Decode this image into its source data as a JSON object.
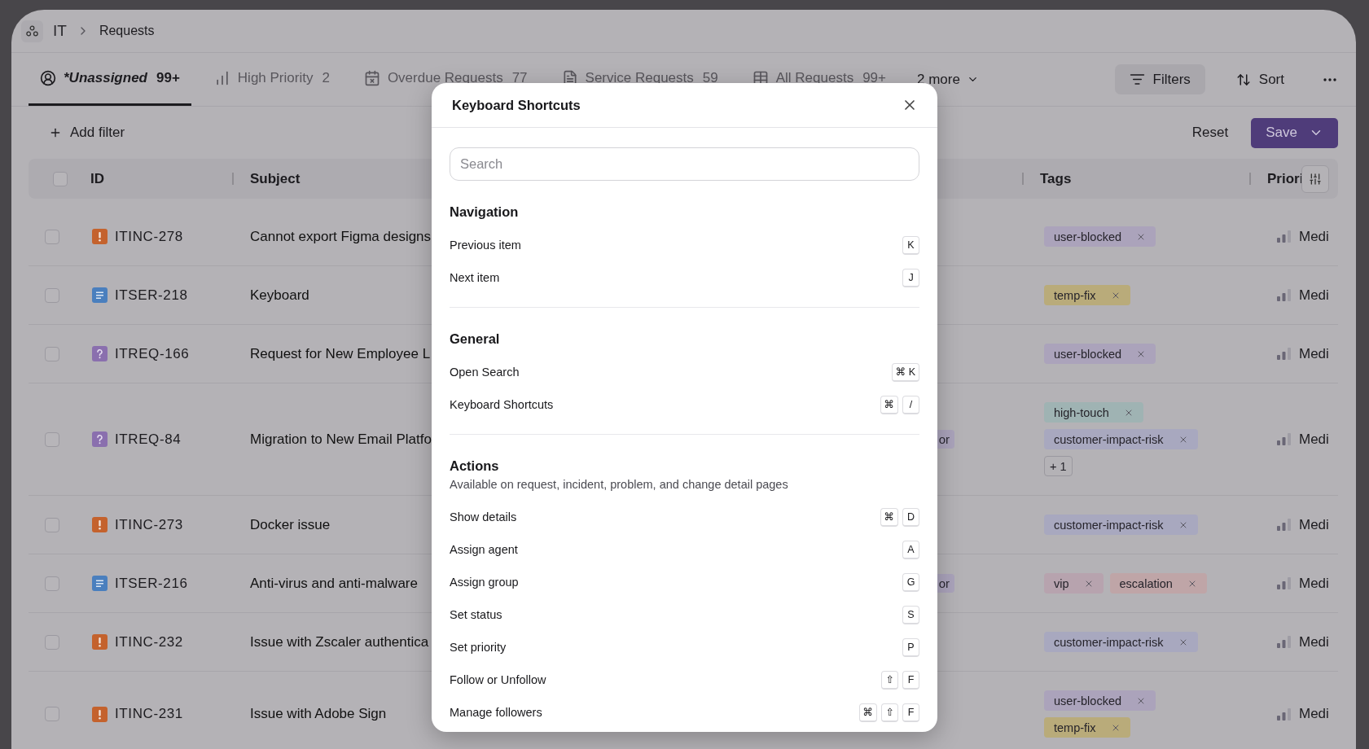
{
  "breadcrumb": {
    "items": [
      "IT",
      "Requests"
    ]
  },
  "tabs": [
    {
      "label": "*Unassigned",
      "count": "99+",
      "selected": true
    },
    {
      "label": "High Priority",
      "count": "2",
      "selected": false
    },
    {
      "label": "Overdue Requests",
      "count": "77",
      "selected": false
    },
    {
      "label": "Service Requests",
      "count": "59",
      "selected": false
    },
    {
      "label": "All Requests",
      "count": "99+",
      "selected": false
    }
  ],
  "more_tabs": "2 more",
  "toolbar": {
    "filters": "Filters",
    "sort": "Sort"
  },
  "add_filter": "Add filter",
  "actions": {
    "reset": "Reset",
    "save": "Save"
  },
  "table": {
    "header_checked": false,
    "columns": [
      "ID",
      "Subject",
      "Tags",
      "Priori"
    ],
    "rows": [
      {
        "checked": false,
        "kind": "incident",
        "id": "ITINC-278",
        "subject": "Cannot export Figma designs",
        "tag_lines": [
          [
            {
              "label": "user-blocked",
              "color": "#aba3bb"
            }
          ]
        ],
        "priority": "Medi"
      },
      {
        "checked": false,
        "kind": "service",
        "id": "ITSER-218",
        "subject": "Keyboard",
        "tag_lines": [
          [
            {
              "label": "temp-fix",
              "color": "#b9ab7a"
            }
          ]
        ],
        "priority": "Medi"
      },
      {
        "checked": false,
        "kind": "request",
        "id": "ITREQ-166",
        "subject": "Request for New Employee L",
        "tag_lines": [
          [
            {
              "label": "user-blocked",
              "color": "#aba3bb"
            }
          ]
        ],
        "priority": "Medi"
      },
      {
        "checked": false,
        "kind": "request",
        "id": "ITREQ-84",
        "subject": "Migration to New Email Platfo",
        "column_3": "or",
        "tag_lines": [
          [
            {
              "label": "high-touch",
              "color": "#9fb3b3"
            }
          ],
          [
            {
              "label": "customer-impact-risk",
              "color": "#a8a8bf"
            }
          ]
        ],
        "more_tags": "+ 1",
        "priority": "Medi"
      },
      {
        "checked": false,
        "kind": "incident",
        "id": "ITINC-273",
        "subject": "Docker issue",
        "tag_lines": [
          [
            {
              "label": "customer-impact-risk",
              "color": "#a8a8bf"
            }
          ]
        ],
        "priority": "Medi"
      },
      {
        "checked": false,
        "kind": "service",
        "id": "ITSER-216",
        "subject": "Anti-virus and anti-malware",
        "column_3": "or",
        "tag_lines": [
          [
            {
              "label": "vip",
              "color": "#b7a3ae"
            },
            {
              "label": "escalation",
              "color": "#bfa5a7"
            }
          ]
        ],
        "priority": "Medi"
      },
      {
        "checked": false,
        "kind": "incident",
        "id": "ITINC-232",
        "subject": "Issue with Zscaler authentica",
        "tag_lines": [
          [
            {
              "label": "customer-impact-risk",
              "color": "#a8a8bf"
            }
          ]
        ],
        "priority": "Medi"
      },
      {
        "checked": false,
        "kind": "incident",
        "id": "ITINC-231",
        "subject": "Issue with Adobe Sign",
        "tag_lines": [
          [
            {
              "label": "user-blocked",
              "color": "#aba3bb"
            }
          ],
          [
            {
              "label": "temp-fix",
              "color": "#b9ab7a"
            }
          ]
        ],
        "priority": "Medi"
      }
    ]
  },
  "modal": {
    "title": "Keyboard Shortcuts",
    "search": {
      "placeholder": "Search"
    },
    "sections": [
      {
        "title": "Navigation",
        "items": [
          {
            "label": "Previous item",
            "keys": [
              "K"
            ]
          },
          {
            "label": "Next item",
            "keys": [
              "J"
            ]
          }
        ]
      },
      {
        "title": "General",
        "items": [
          {
            "label": "Open Search",
            "keys": [
              "⌘ K"
            ]
          },
          {
            "label": "Keyboard Shortcuts",
            "keys": [
              "⌘",
              "/"
            ]
          }
        ]
      },
      {
        "title": "Actions",
        "description": "Available on request, incident, problem, and change detail pages",
        "items": [
          {
            "label": "Show details",
            "keys": [
              "⌘",
              "D"
            ]
          },
          {
            "label": "Assign agent",
            "keys": [
              "A"
            ]
          },
          {
            "label": "Assign group",
            "keys": [
              "G"
            ]
          },
          {
            "label": "Set status",
            "keys": [
              "S"
            ]
          },
          {
            "label": "Set priority",
            "keys": [
              "P"
            ]
          },
          {
            "label": "Follow or Unfollow",
            "keys": [
              "⇧",
              "F"
            ]
          },
          {
            "label": "Manage followers",
            "keys": [
              "⌘",
              "⇧",
              "F"
            ]
          }
        ]
      }
    ]
  }
}
